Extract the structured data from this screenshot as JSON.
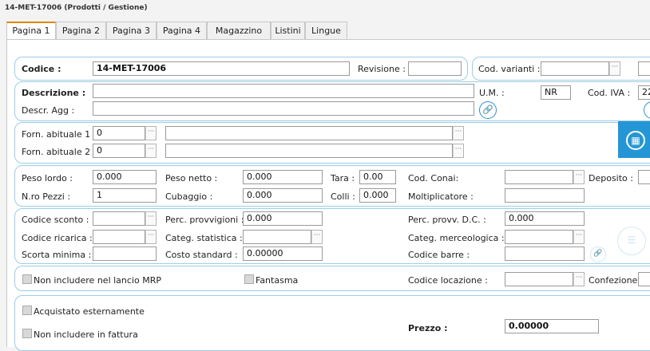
{
  "window": {
    "title": "14-MET-17006  (Prodotti / Gestione)"
  },
  "tabs": [
    "Pagina 1",
    "Pagina 2",
    "Pagina 3",
    "Pagina 4",
    "Magazzino",
    "Listini",
    "Lingue"
  ],
  "codice": {
    "label": "Codice :",
    "value": "14-MET-17006",
    "revisione_label": "Revisione :",
    "revisione_value": ""
  },
  "varianti": {
    "label": "Cod. varianti :",
    "value": ""
  },
  "descrizione": {
    "label": "Descrizione :",
    "value": "",
    "agg_label": "Descr. Agg :",
    "agg_value": ""
  },
  "um": {
    "label": "U.M. :",
    "value": "NR"
  },
  "iva": {
    "label": "Cod. IVA :",
    "value": "22"
  },
  "fornitori": {
    "forn1_label": "Forn. abituale 1 :",
    "forn1_code": "0",
    "forn1_name": "",
    "forn2_label": "Forn. abituale 2 :",
    "forn2_code": "0",
    "forn2_name": ""
  },
  "pesi": {
    "peso_lordo_label": "Peso lordo :",
    "peso_lordo": "0.000",
    "peso_netto_label": "Peso netto :",
    "peso_netto": "0.000",
    "tara_label": "Tara :",
    "tara": "0.00",
    "conai_label": "Cod. Conai:",
    "conai": "",
    "deposito_label": "Deposito :",
    "deposito": "",
    "pezzi_label": "N.ro Pezzi :",
    "pezzi": "1",
    "cubaggio_label": "Cubaggio :",
    "cubaggio": "0.000",
    "colli_label": "Colli :",
    "colli": "0.000",
    "moltiplicatore_label": "Moltiplicatore :",
    "moltiplicatore": ""
  },
  "commerciali": {
    "sconto_label": "Codice sconto :",
    "sconto": "",
    "provvigioni_label": "Perc. provvigioni :",
    "provvigioni": "0.000",
    "provv_dc_label": "Perc. provv. D.C. :",
    "provv_dc": "0.000",
    "ricarica_label": "Codice ricarica :",
    "ricarica": "",
    "stat_label": "Categ. statistica :",
    "stat": "",
    "merceologica_label": "Categ. merceologica :",
    "merceologica": "",
    "scorta_label": "Scorta minima :",
    "scorta": "",
    "costo_label": "Costo standard :",
    "costo": "0.00000",
    "barre_label": "Codice barre :",
    "barre": ""
  },
  "mrp": {
    "no_mrp_label": "Non includere nel lancio MRP",
    "fantasma_label": "Fantasma",
    "locazione_label": "Codice locazione :",
    "locazione": "",
    "confezione_label": "Confezione",
    "confezione": ""
  },
  "acquisti": {
    "esterno_label": "Acquistato esternamente",
    "no_fattura_label": "Non includere in fattura",
    "prezzo_label": "Prezzo :",
    "prezzo": "0.00000"
  }
}
